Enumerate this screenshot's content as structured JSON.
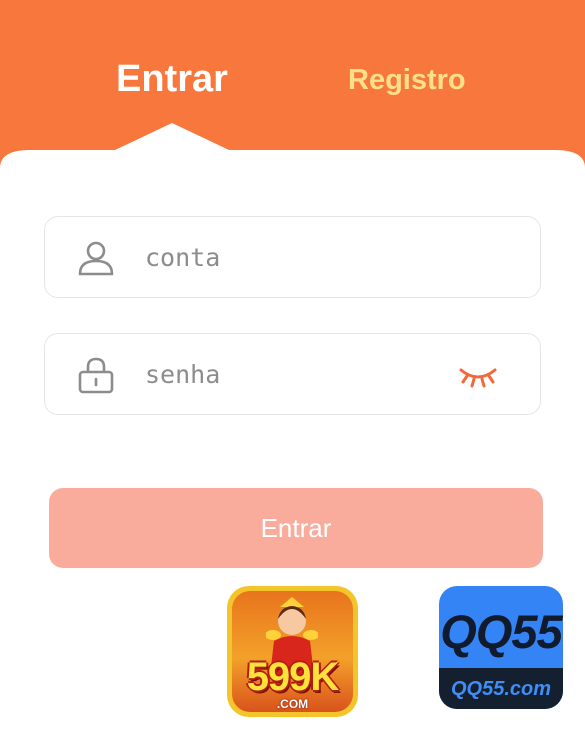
{
  "tabs": {
    "login_label": "Entrar",
    "register_label": "Registro"
  },
  "form": {
    "account_placeholder": "conta",
    "password_placeholder": "senha",
    "submit_label": "Entrar"
  },
  "icons": {
    "account": "user-icon",
    "password": "lock-icon",
    "toggle_visibility": "eye-closed-icon"
  },
  "logos": {
    "left": {
      "brand": "599K",
      "sub": ".COM"
    },
    "right": {
      "brand": "QQ55",
      "sub": "QQ55.com"
    }
  },
  "colors": {
    "header": "#f8773c",
    "register_tab": "#ffe08a",
    "submit_bg": "#f9a897",
    "eye_icon": "#f06a3a"
  }
}
